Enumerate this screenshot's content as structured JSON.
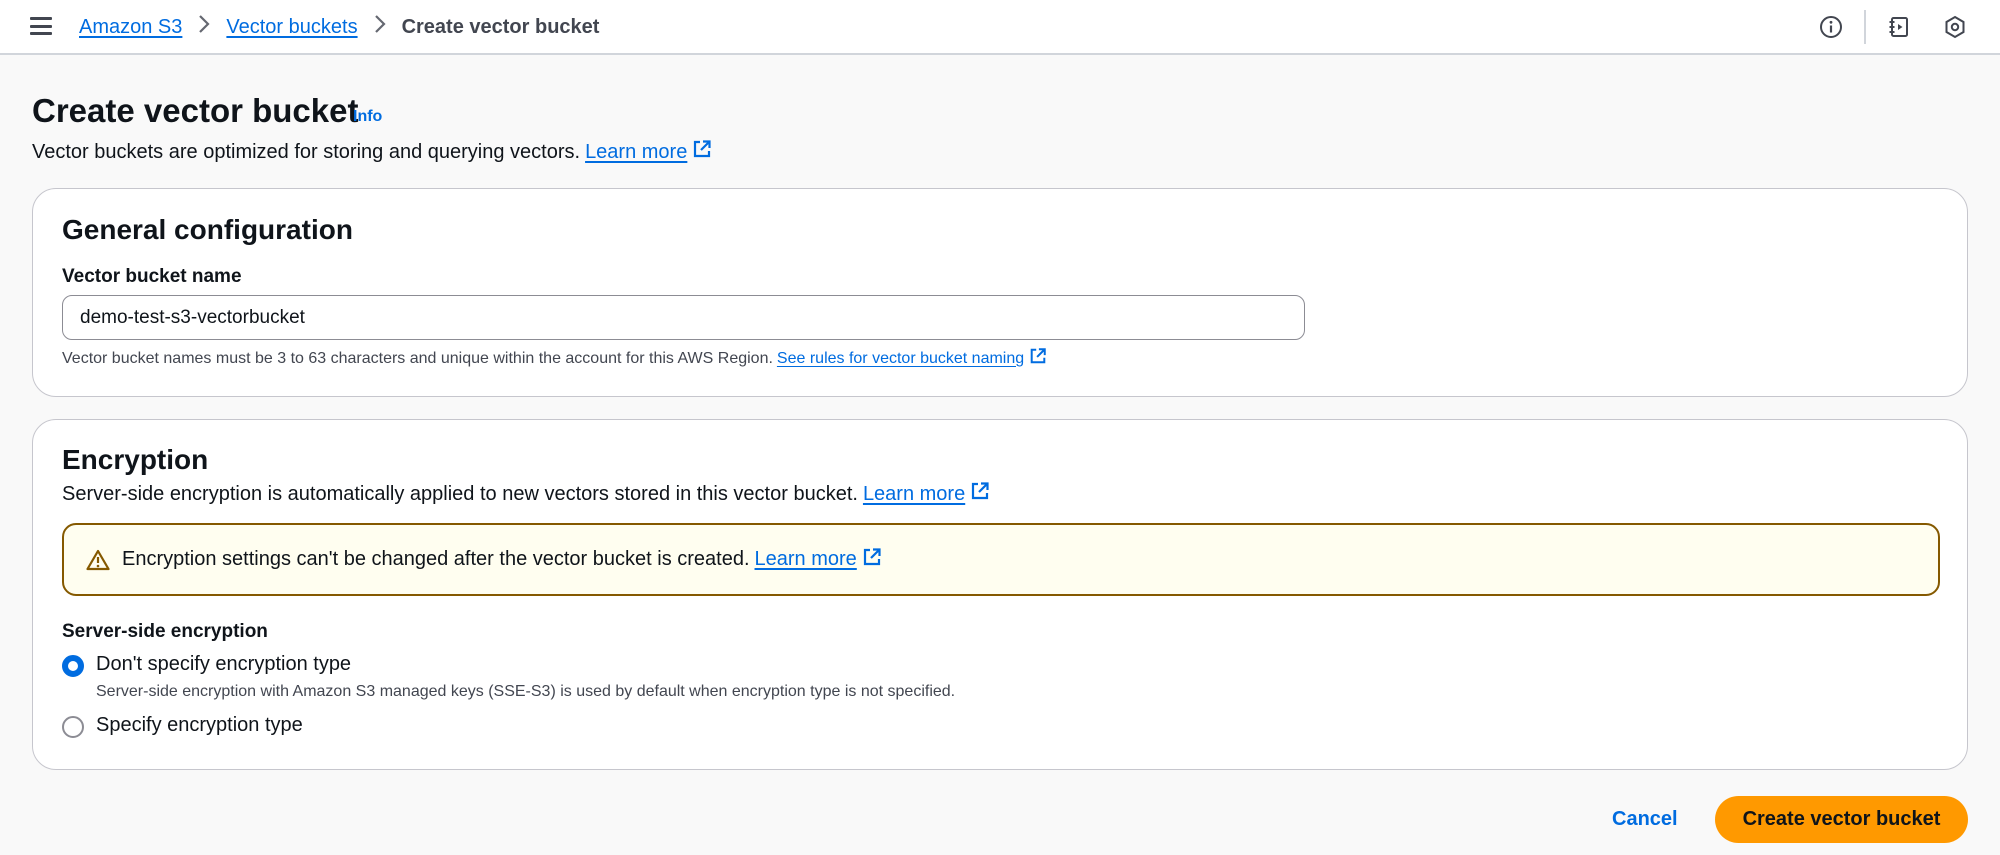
{
  "breadcrumb": {
    "items": [
      "Amazon S3",
      "Vector buckets"
    ],
    "current": "Create vector bucket"
  },
  "header": {
    "title": "Create vector bucket",
    "info_label": "Info",
    "description": "Vector buckets are optimized for storing and querying vectors.",
    "learn_more": "Learn more"
  },
  "general": {
    "heading": "General configuration",
    "name_label": "Vector bucket name",
    "name_value": "demo-test-s3-vectorbucket",
    "hint": "Vector bucket names must be 3 to 63 characters and unique within the account for this AWS Region.",
    "rules_link": "See rules for vector bucket naming"
  },
  "encryption": {
    "heading": "Encryption",
    "description": "Server-side encryption is automatically applied to new vectors stored in this vector bucket.",
    "learn_more": "Learn more",
    "alert_text": "Encryption settings can't be changed after the vector bucket is created.",
    "alert_learn_more": "Learn more",
    "sse_label": "Server-side encryption",
    "options": [
      {
        "label": "Don't specify encryption type",
        "description": "Server-side encryption with Amazon S3 managed keys (SSE-S3) is used by default when encryption type is not specified.",
        "selected": true
      },
      {
        "label": "Specify encryption type",
        "description": "",
        "selected": false
      }
    ]
  },
  "actions": {
    "cancel": "Cancel",
    "submit": "Create vector bucket"
  },
  "colors": {
    "link": "#006ce0",
    "primary": "#ff9900",
    "warning_border": "#855900",
    "warning_bg": "#fffef0"
  },
  "icons": [
    "menu-icon",
    "info-circle-icon",
    "notes-icon",
    "settings-hex-icon",
    "external-link-icon",
    "warning-icon"
  ]
}
